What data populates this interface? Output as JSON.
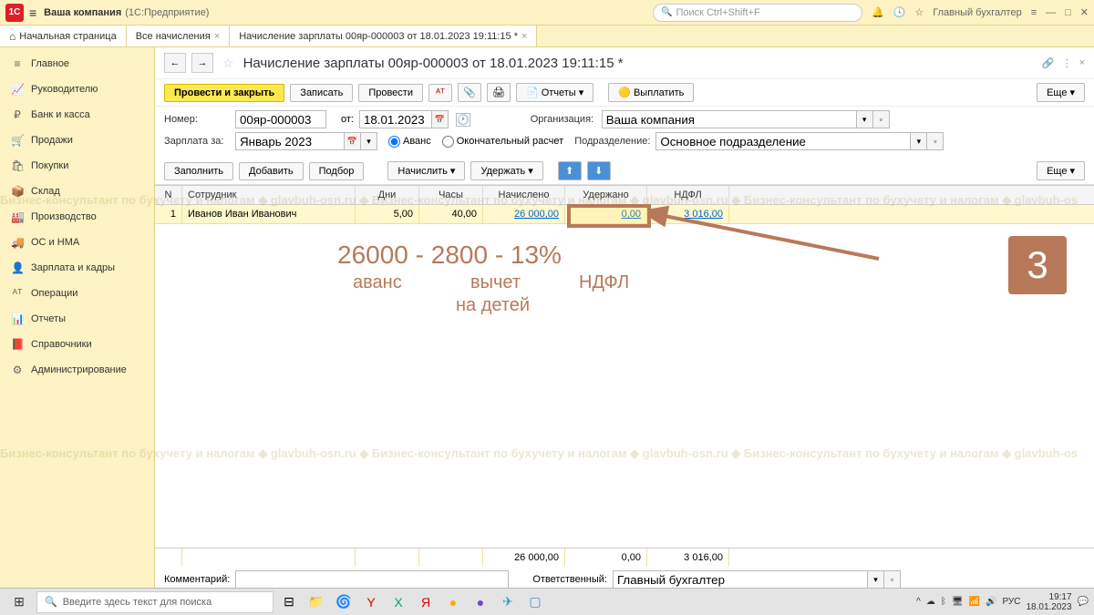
{
  "titlebar": {
    "company": "Ваша компания",
    "product": "(1С:Предприятие)",
    "search_placeholder": "Поиск Ctrl+Shift+F",
    "user": "Главный бухгалтер"
  },
  "tabs": {
    "home": "Начальная страница",
    "list": "Все начисления",
    "doc": "Начисление зарплаты 00яр-000003 от 18.01.2023 19:11:15 *"
  },
  "sidebar": {
    "items": [
      {
        "icon": "≡",
        "label": "Главное"
      },
      {
        "icon": "📈",
        "label": "Руководителю"
      },
      {
        "icon": "₽",
        "label": "Банк и касса"
      },
      {
        "icon": "🛒",
        "label": "Продажи"
      },
      {
        "icon": "🛍",
        "label": "Покупки"
      },
      {
        "icon": "📦",
        "label": "Склад"
      },
      {
        "icon": "🏭",
        "label": "Производство"
      },
      {
        "icon": "🚚",
        "label": "ОС и НМА"
      },
      {
        "icon": "👤",
        "label": "Зарплата и кадры"
      },
      {
        "icon": "ᴬᵀ",
        "label": "Операции"
      },
      {
        "icon": "📊",
        "label": "Отчеты"
      },
      {
        "icon": "📕",
        "label": "Справочники"
      },
      {
        "icon": "⚙",
        "label": "Администрирование"
      }
    ]
  },
  "doc": {
    "title": "Начисление зарплаты 00яр-000003 от 18.01.2023 19:11:15 *",
    "toolbar": {
      "post_close": "Провести и закрыть",
      "save": "Записать",
      "post": "Провести",
      "reports": "Отчеты",
      "pay": "Выплатить",
      "more": "Еще"
    },
    "fields": {
      "number_label": "Номер:",
      "number": "00яр-000003",
      "from_label": "от:",
      "date": "18.01.2023",
      "org_label": "Организация:",
      "org": "Ваша компания",
      "period_label": "Зарплата за:",
      "period": "Январь 2023",
      "advance": "Аванс",
      "final": "Окончательный расчет",
      "dept_label": "Подразделение:",
      "dept": "Основное подразделение"
    },
    "toolbar2": {
      "fill": "Заполнить",
      "add": "Добавить",
      "pick": "Подбор",
      "accrue": "Начислить",
      "withhold": "Удержать",
      "more": "Еще"
    },
    "table": {
      "cols": {
        "n": "N",
        "emp": "Сотрудник",
        "days": "Дни",
        "hours": "Часы",
        "accrued": "Начислено",
        "withheld": "Удержано",
        "ndfl": "НДФЛ"
      },
      "row": {
        "n": "1",
        "emp": "Иванов Иван Иванович",
        "days": "5,00",
        "hours": "40,00",
        "accrued": "26 000,00",
        "withheld": "0,00",
        "ndfl": "3 016,00"
      },
      "totals": {
        "accrued": "26 000,00",
        "withheld": "0,00",
        "ndfl": "3 016,00"
      }
    },
    "footer": {
      "comment_label": "Комментарий:",
      "resp_label": "Ответственный:",
      "resp": "Главный бухгалтер"
    }
  },
  "annotation": {
    "formula": "26000 - 2800 - 13%",
    "labels": {
      "advance": "аванс",
      "deduct1": "вычет",
      "deduct2": "на детей",
      "ndfl": "НДФЛ"
    },
    "step": "3"
  },
  "taskbar": {
    "search": "Введите здесь текст для поиска",
    "lang": "РУС",
    "time": "19:17",
    "date": "18.01.2023"
  },
  "watermark": "Бизнес-консультант по бухучету и налогам ◆ glavbuh-osn.ru ◆ Бизнес-консультант по бухучету и налогам ◆ glavbuh-osn.ru ◆ Бизнес-консультант по бухучету и налогам ◆ glavbuh-os"
}
